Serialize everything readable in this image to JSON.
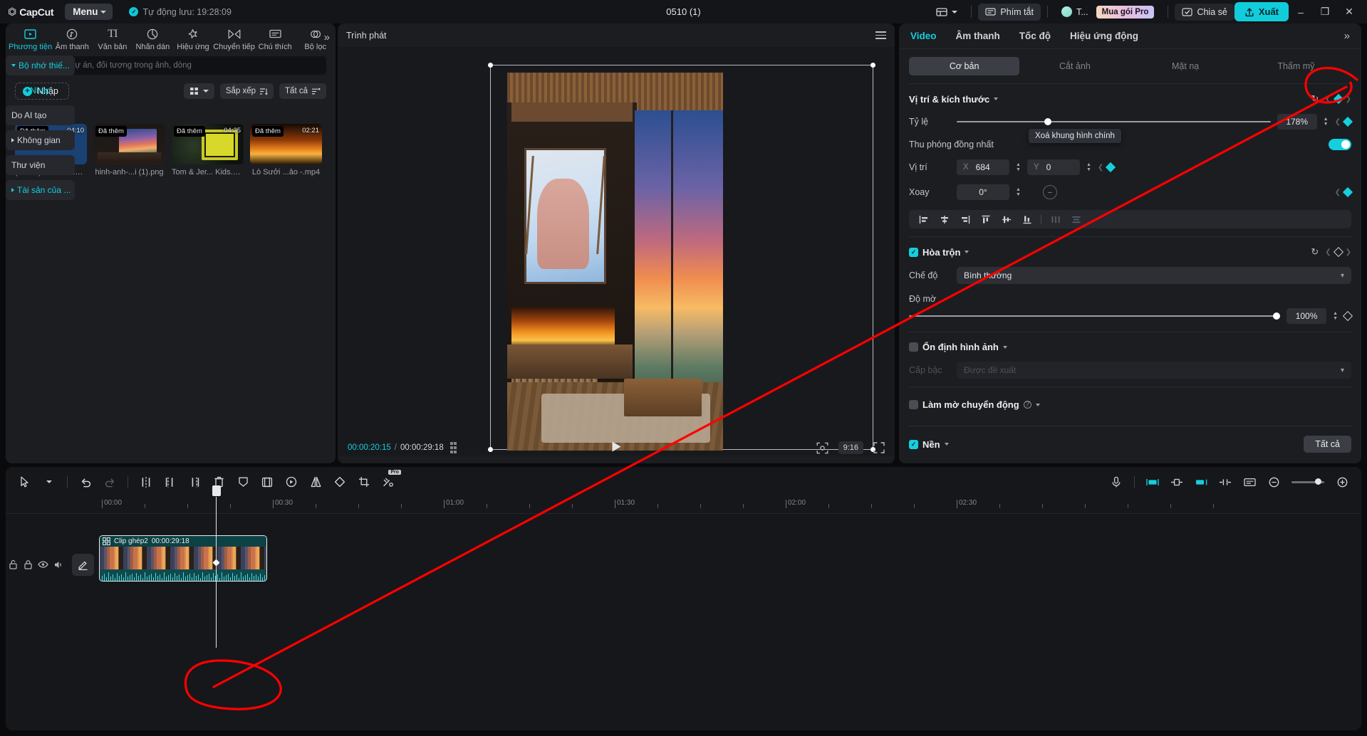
{
  "titlebar": {
    "brand": "CapCut",
    "menu_label": "Menu",
    "autosave": "Tự động lưu: 19:28:09",
    "project_title": "0510 (1)",
    "layout_icon": "layout-icon",
    "shortcuts_label": "Phím tắt",
    "account_name": "T...",
    "pro_label": "Mua gói Pro",
    "share_label": "Chia sẻ",
    "export_label": "Xuất",
    "minimize": "—",
    "maximize": "❐",
    "close": "✕"
  },
  "media": {
    "tabs": [
      {
        "label": "Phương tiện",
        "icon": "media-icon",
        "active": true
      },
      {
        "label": "Âm thanh",
        "icon": "audio-note-icon",
        "active": false
      },
      {
        "label": "Văn bản",
        "icon": "text-icon",
        "active": false
      },
      {
        "label": "Nhãn dán",
        "icon": "sticker-icon",
        "active": false
      },
      {
        "label": "Hiệu ứng",
        "icon": "effects-star-icon",
        "active": false
      },
      {
        "label": "Chuyển tiếp",
        "icon": "transition-icon",
        "active": false
      },
      {
        "label": "Chú thích",
        "icon": "caption-icon",
        "active": false
      },
      {
        "label": "Bộ lọc",
        "icon": "filter-icon",
        "active": false
      }
    ],
    "search_placeholder": "Tìm kiếm dự án, đối tượng trong ảnh, dòng",
    "import_label": "Nhập",
    "view_label": "grid-view-icon",
    "sort_label": "Sắp xếp",
    "filter_label": "Tất cả",
    "section_label": "Tất cả",
    "nav": [
      {
        "label": "Bộ nhớ thiế...",
        "expandable": true,
        "style": "teal"
      },
      {
        "label": "Nhập",
        "expandable": false,
        "style": "plain"
      },
      {
        "label": "Do AI tạo",
        "expandable": false,
        "style": "normal"
      },
      {
        "label": "Không gian",
        "expandable": true,
        "style": "normal"
      },
      {
        "label": "Thư viện",
        "expandable": false,
        "style": "normal"
      },
      {
        "label": "Tài sản của ...",
        "expandable": true,
        "style": "teal"
      }
    ],
    "items": [
      {
        "badge": "Đã thêm",
        "duration": "04:10",
        "name": "(FREE) Lo... Girl.mp3",
        "art": "audio"
      },
      {
        "badge": "Đã thêm",
        "duration": "",
        "name": "hinh-anh-...i (1).png",
        "art": "room"
      },
      {
        "badge": "Đã thêm",
        "duration": "04:35",
        "name": "Tom & Jer... Kids.mp4",
        "art": "cartoon"
      },
      {
        "badge": "Đã thêm",
        "duration": "02:21",
        "name": "Lò Sưởi ...ảo -.mp4",
        "art": "fire"
      }
    ]
  },
  "player": {
    "title": "Trình phát",
    "menu_icon": "hamburger-icon",
    "current_time": "00:00:20:15",
    "separator": "/",
    "total_time": "00:00:29:18",
    "grid_icon": "grid-icon",
    "play_icon": "play-icon",
    "fit_icon": "fit-screen-icon",
    "ratio": "9:16",
    "fullscreen_icon": "fullscreen-icon"
  },
  "props": {
    "tabs": [
      {
        "label": "Video",
        "active": true
      },
      {
        "label": "Âm thanh",
        "active": false
      },
      {
        "label": "Tốc độ",
        "active": false
      },
      {
        "label": "Hiệu ứng động",
        "active": false
      }
    ],
    "more_icon": "chevron-double-right-icon",
    "segments": [
      {
        "label": "Cơ bản",
        "active": true
      },
      {
        "label": "Cắt ảnh",
        "active": false
      },
      {
        "label": "Mặt nạ",
        "active": false
      },
      {
        "label": "Thẩm mỹ",
        "active": false
      }
    ],
    "position_size": {
      "title": "Vị trí & kích thước",
      "tooltip": "Xoá khung hình chính",
      "scale_label": "Tỷ lệ",
      "scale_value": "178%",
      "uniform_label": "Thu phóng đồng nhất",
      "uniform_on": true,
      "position_label": "Vị trí",
      "pos_x_tag": "X",
      "pos_x": "684",
      "pos_y_tag": "Y",
      "pos_y": "0",
      "rotate_label": "Xoay",
      "rotate_value": "0°"
    },
    "blend": {
      "title": "Hòa trộn",
      "checked": true,
      "mode_label": "Chế độ",
      "mode_value": "Bình thường",
      "opacity_label": "Độ mờ",
      "opacity_value": "100%"
    },
    "stabilize": {
      "title": "Ổn định hình ảnh",
      "checked": false,
      "sub_label": "Cấp bậc",
      "sub_value": "Được đề xuất"
    },
    "motion_blur": {
      "title": "Làm mờ chuyển động",
      "checked": false
    },
    "background": {
      "title": "Nền",
      "checked": true,
      "action_label": "Tất cả"
    }
  },
  "timeline": {
    "tools": [
      {
        "icon": "select-arrow-icon",
        "name": "select-tool"
      },
      {
        "icon": "chevron-down-icon",
        "name": "select-dropdown"
      },
      {
        "icon": "undo-icon",
        "name": "undo"
      },
      {
        "icon": "redo-icon",
        "name": "redo"
      },
      {
        "icon": "split-icon",
        "name": "split"
      },
      {
        "icon": "trim-left-icon",
        "name": "trim-left"
      },
      {
        "icon": "trim-right-icon",
        "name": "trim-right"
      },
      {
        "icon": "delete-icon",
        "name": "delete"
      },
      {
        "icon": "freeze-icon",
        "name": "freeze"
      },
      {
        "icon": "pip-icon",
        "name": "picture-in-picture"
      },
      {
        "icon": "reverse-icon",
        "name": "reverse"
      },
      {
        "icon": "mirror-icon",
        "name": "mirror"
      },
      {
        "icon": "rotate-icon",
        "name": "rotate"
      },
      {
        "icon": "crop-icon",
        "name": "crop"
      },
      {
        "icon": "remove-bg-icon",
        "name": "remove-background",
        "pro": "Pro"
      }
    ],
    "right_tools": [
      {
        "icon": "mic-icon",
        "name": "record-voiceover"
      },
      {
        "icon": "track-fit-icon",
        "name": "adapt-track"
      },
      {
        "icon": "auto-icon",
        "name": "auto-layout"
      },
      {
        "icon": "marker-icon",
        "name": "marker"
      },
      {
        "icon": "link-icon",
        "name": "link-clips"
      },
      {
        "icon": "caption-track-icon",
        "name": "caption-track"
      },
      {
        "icon": "zoom-out-icon",
        "name": "zoom-out"
      },
      {
        "icon": "zoom-in-icon",
        "name": "zoom-in"
      }
    ],
    "ruler_labels": [
      "00:00",
      "00:30",
      "01:00",
      "01:30",
      "02:00",
      "02:30"
    ],
    "gutter_icons": [
      {
        "icon": "unlock-icon",
        "name": "track-lock"
      },
      {
        "icon": "lock-icon",
        "name": "lock-track"
      },
      {
        "icon": "eye-icon",
        "name": "toggle-visibility"
      },
      {
        "icon": "volume-icon",
        "name": "toggle-mute"
      }
    ],
    "edit_icon": "pencil-icon",
    "clip": {
      "icon": "compound-clip-icon",
      "name": "Clip ghép2",
      "duration": "00:00:29:18"
    }
  }
}
